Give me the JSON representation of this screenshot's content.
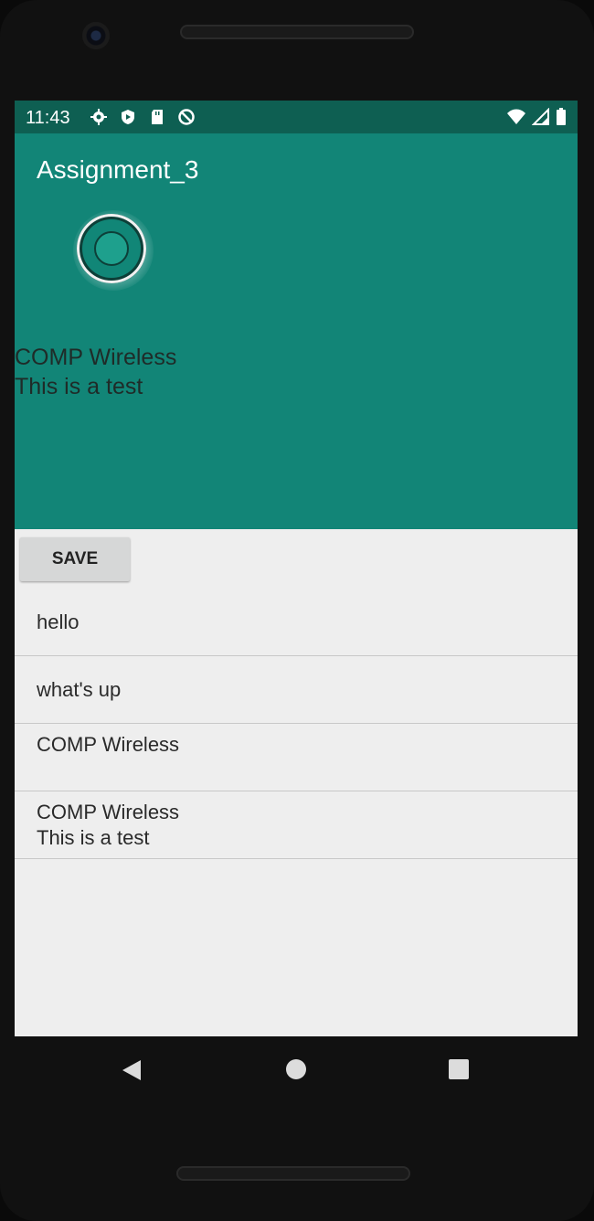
{
  "status_bar": {
    "time": "11:43",
    "icons_left": [
      "gear-icon",
      "shield-icon",
      "sd-card-icon",
      "block-icon"
    ],
    "icons_right": [
      "wifi-icon",
      "signal-icon",
      "battery-icon"
    ]
  },
  "app_bar": {
    "title": "Assignment_3"
  },
  "hero": {
    "line1": "COMP Wireless",
    "line2": "This is a test"
  },
  "save_button": {
    "label": "SAVE"
  },
  "list_items": [
    {
      "line1": "hello",
      "line2": ""
    },
    {
      "line1": "what's up",
      "line2": ""
    },
    {
      "line1": "COMP Wireless",
      "line2": ""
    },
    {
      "line1": "COMP Wireless",
      "line2": "This is a test"
    }
  ],
  "colors": {
    "status_bar": "#0e5f52",
    "primary": "#128577",
    "background": "#eeeeee"
  }
}
